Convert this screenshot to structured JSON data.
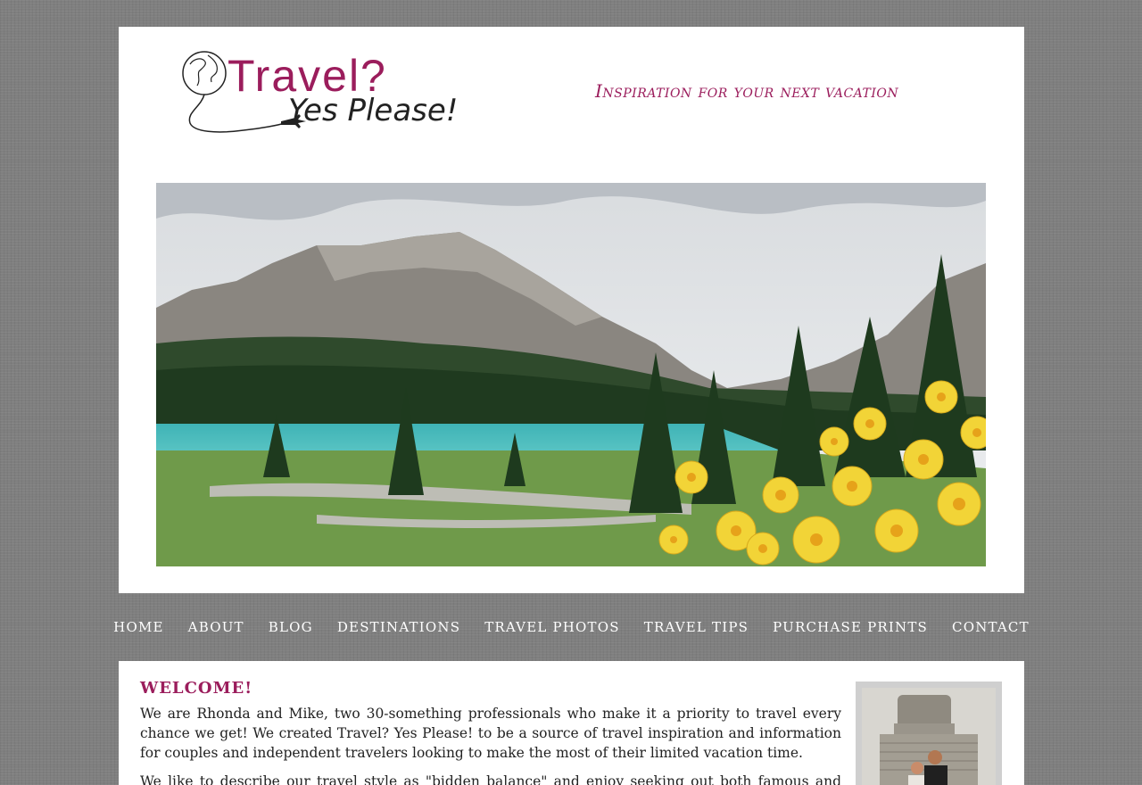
{
  "header": {
    "logo_text": "Travel?",
    "logo_subtext": "Yes Please!",
    "tagline": "Inspiration for your next vacation"
  },
  "hero": {
    "icon": "lake-mountain-photo"
  },
  "nav": {
    "items": [
      {
        "label": "HOME"
      },
      {
        "label": "ABOUT"
      },
      {
        "label": "BLOG"
      },
      {
        "label": "DESTINATIONS"
      },
      {
        "label": "TRAVEL PHOTOS"
      },
      {
        "label": "TRAVEL TIPS"
      },
      {
        "label": "PURCHASE PRINTS"
      },
      {
        "label": "CONTACT"
      }
    ]
  },
  "welcome": {
    "title": "WELCOME!",
    "paragraph1": "We are Rhonda and Mike, two 30-something professionals who make it a priority to travel every chance we get! We created Travel? Yes Please! to be a source of travel inspiration and information for couples and independent travelers looking to make the most of their limited vacation time.",
    "paragraph2": "We like to describe our travel style as \"bidden balance\" and enjoy seeking out both famous and secret sights."
  },
  "colors": {
    "accent": "#9b1d5c",
    "background": "#7f7f7f"
  }
}
